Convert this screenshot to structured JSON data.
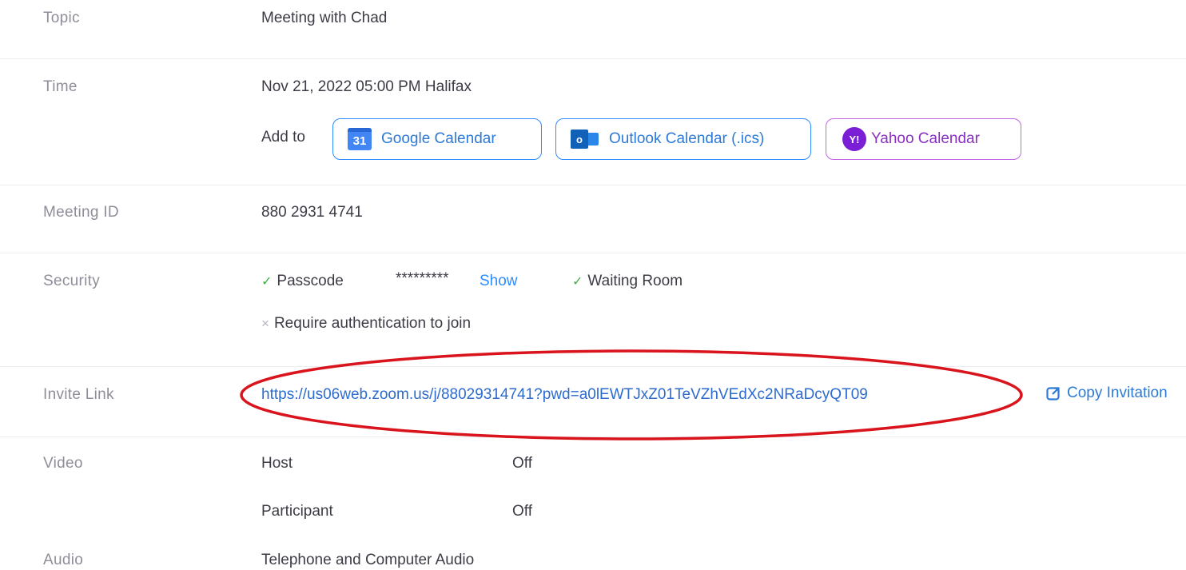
{
  "topic": {
    "label": "Topic",
    "value": "Meeting with Chad"
  },
  "time": {
    "label": "Time",
    "value": "Nov 21, 2022 05:00 PM Halifax",
    "add_to_label": "Add to",
    "google_calendar": {
      "label": "Google Calendar",
      "icon": "google-calendar-icon",
      "icon_text": "31"
    },
    "outlook_calendar": {
      "label": "Outlook Calendar (.ics)",
      "icon": "outlook-icon",
      "icon_text": "o"
    },
    "yahoo_calendar": {
      "label": "Yahoo Calendar",
      "icon": "yahoo-icon",
      "icon_text": "Y!"
    }
  },
  "meeting_id": {
    "label": "Meeting ID",
    "value": "880 2931 4741"
  },
  "security": {
    "label": "Security",
    "passcode_label": "Passcode",
    "passcode_masked": "*********",
    "show_label": "Show",
    "waiting_room_label": "Waiting Room",
    "auth_label": "Require authentication to join",
    "check_icon": "✓",
    "cross_icon": "×"
  },
  "invite": {
    "label": "Invite Link",
    "url": "https://us06web.zoom.us/j/88029314741?pwd=a0lEWTJxZ01TeVZhVEdXc2NRaDcyQT09",
    "copy_label": "Copy Invitation"
  },
  "video": {
    "label": "Video",
    "host_label": "Host",
    "host_value": "Off",
    "participant_label": "Participant",
    "participant_value": "Off"
  },
  "audio": {
    "label": "Audio",
    "value": "Telephone and Computer Audio"
  },
  "colors": {
    "accent": "#2d8cff",
    "yahoo": "#7b1fd6",
    "highlight_ellipse": "#d9141c",
    "check": "#3fae45"
  }
}
